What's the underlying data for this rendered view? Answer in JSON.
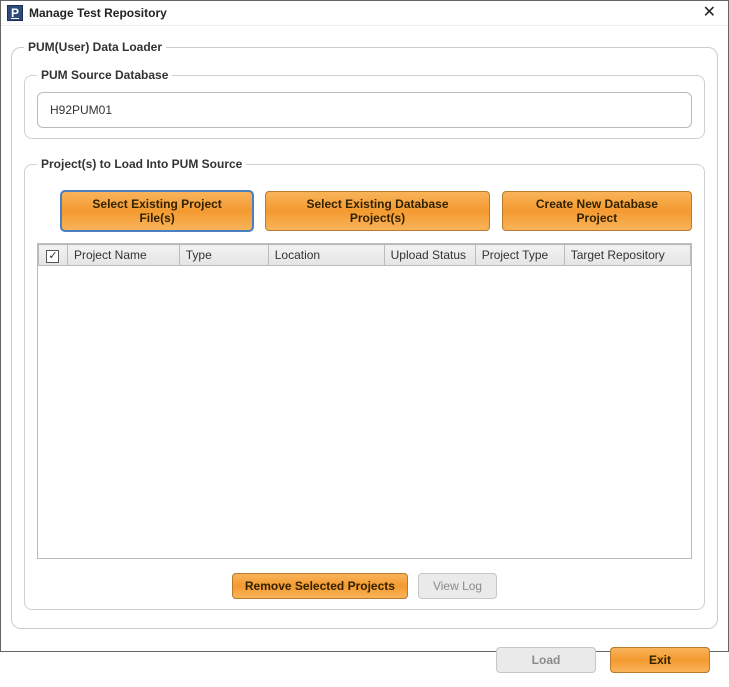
{
  "window": {
    "title": "Manage Test Repository"
  },
  "outer": {
    "legend": "PUM(User) Data Loader"
  },
  "source": {
    "legend": "PUM Source Database",
    "value": "H92PUM01"
  },
  "projects": {
    "legend": "Project(s) to Load Into PUM Source",
    "buttons": {
      "select_file": "Select Existing Project File(s)",
      "select_db": "Select Existing Database Project(s)",
      "create_db": "Create New Database Project"
    },
    "columns": {
      "check": "✓",
      "name": "Project Name",
      "type": "Type",
      "location": "Location",
      "upload_status": "Upload Status",
      "project_type": "Project Type",
      "target_repo": "Target Repository"
    },
    "remove_btn": "Remove Selected Projects",
    "view_log_btn": "View Log"
  },
  "footer": {
    "load": "Load",
    "exit": "Exit"
  }
}
